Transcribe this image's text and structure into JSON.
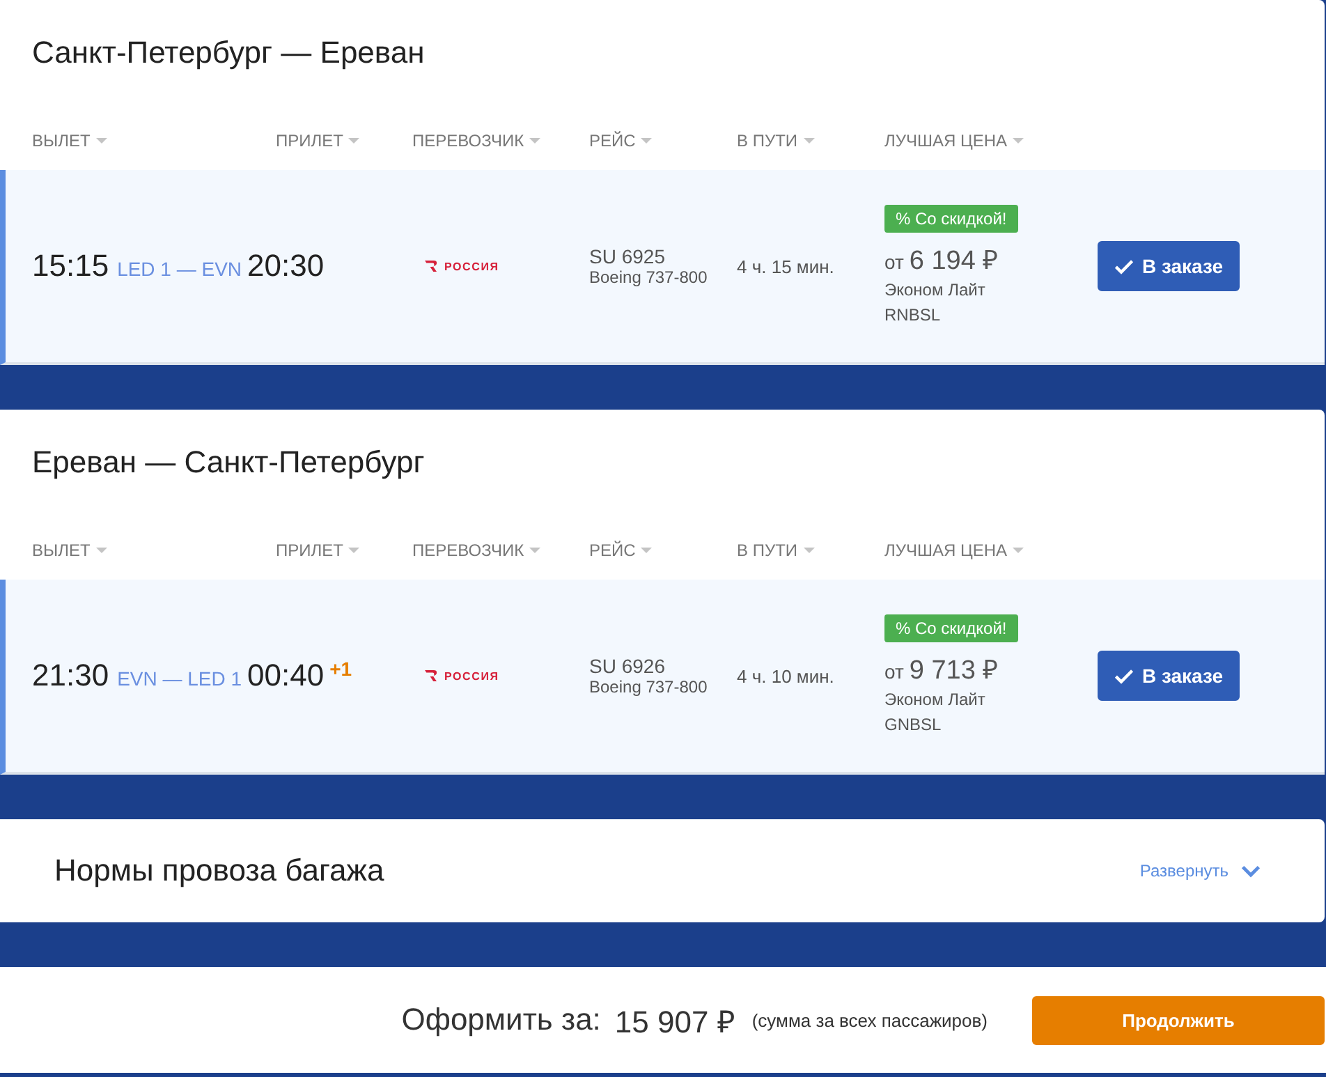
{
  "trips": [
    {
      "title": "Санкт-Петербург — Ереван",
      "columns": [
        "ВЫЛЕТ",
        "ПРИЛЕТ",
        "ПЕРЕВОЗЧИК",
        "РЕЙС",
        "В ПУТИ",
        "ЛУЧШАЯ ЦЕНА"
      ],
      "flight": {
        "selected": true,
        "departure_time": "15:15",
        "route": "LED 1 — EVN",
        "arrival_time": "20:30",
        "carrier": "РОССИЯ",
        "flight_number": "SU 6925",
        "aircraft": "Boeing 737-800",
        "duration": "4 ч. 15 мин.",
        "badge": "% Со скидкой!",
        "price_prefix": "от",
        "price": "6 194 ₽",
        "fare": "Эконом Лайт",
        "fare_code": "RNBSL",
        "button": "В заказе"
      }
    },
    {
      "title": "Ереван — Санкт-Петербург",
      "columns": [
        "ВЫЛЕТ",
        "ПРИЛЕТ",
        "ПЕРЕВОЗЧИК",
        "РЕЙС",
        "В ПУТИ",
        "ЛУЧШАЯ ЦЕНА"
      ],
      "flight": {
        "selected": true,
        "departure_time": "21:30",
        "route": "EVN — LED 1",
        "arrival_time": "00:40",
        "day_offset": "+1",
        "carrier": "РОССИЯ",
        "flight_number": "SU 6926",
        "aircraft": "Boeing 737-800",
        "duration": "4 ч. 10 мин.",
        "badge": "% Со скидкой!",
        "price_prefix": "от",
        "price": "9 713 ₽",
        "fare": "Эконом Лайт",
        "fare_code": "GNBSL",
        "button": "В заказе"
      }
    }
  ],
  "baggage": {
    "title": "Нормы провоза багажа",
    "toggle": "Развернуть",
    "expanded": false
  },
  "checkout": {
    "label": "Оформить за:",
    "total": "15 907 ₽",
    "note": "(сумма за всех пассажиров)",
    "button": "Продолжить"
  }
}
